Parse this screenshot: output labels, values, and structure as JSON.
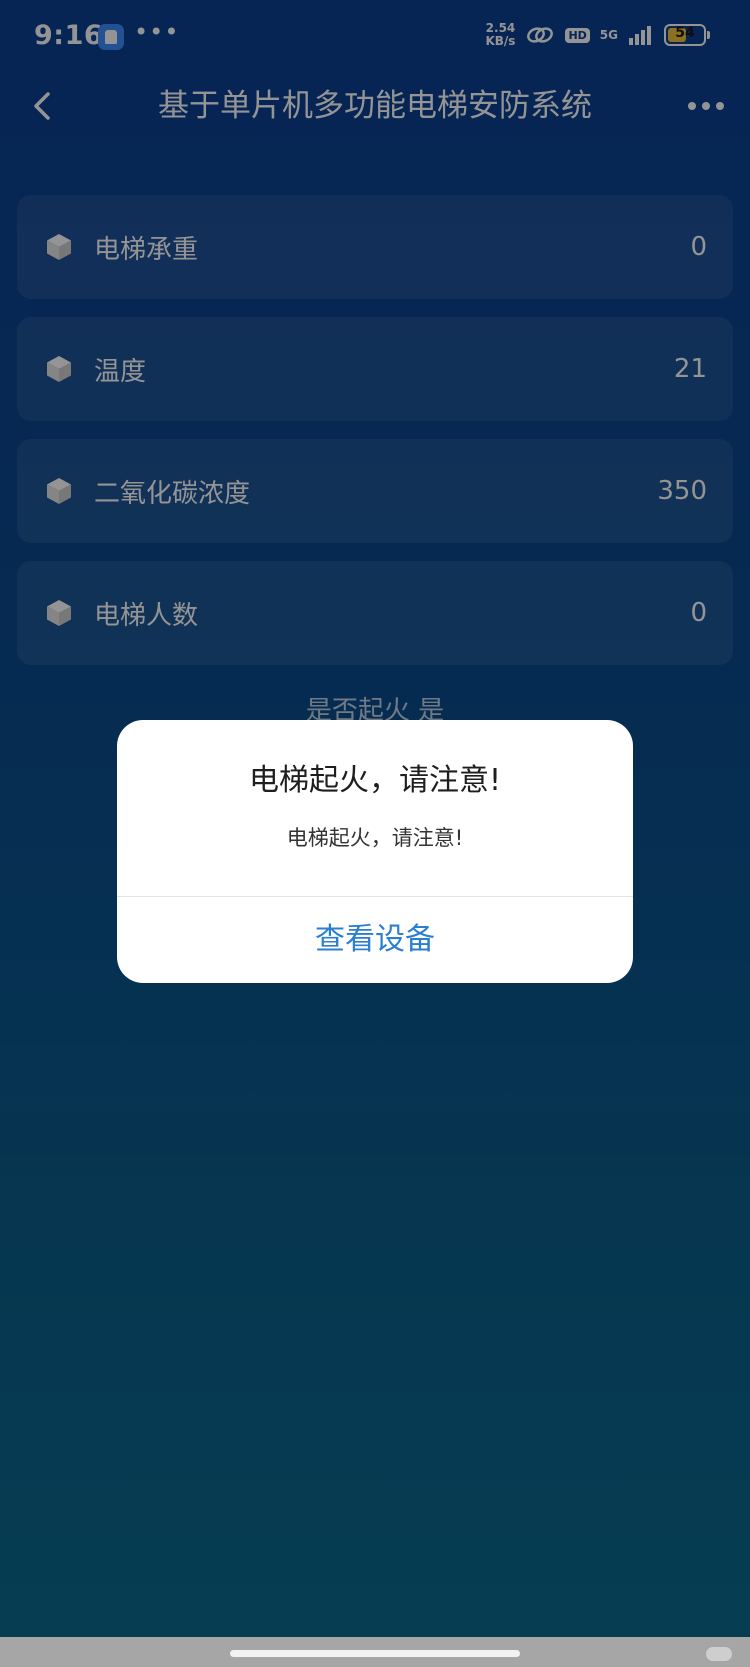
{
  "status_bar": {
    "time": "9:16",
    "more_dots": "•••",
    "speed_value": "2.54",
    "speed_unit": "KB/s",
    "hd_badge": "HD",
    "network": "5G",
    "battery_level": "54",
    "battery_fraction": 0.54,
    "battery_color": "#f3c13a"
  },
  "header": {
    "title": "基于单片机多功能电梯安防系统",
    "back_icon": "chevron-left-icon",
    "more_icon": "more-horizontal-icon"
  },
  "metrics": [
    {
      "label": "电梯承重",
      "value": "0",
      "icon": "cube-icon"
    },
    {
      "label": "温度",
      "value": "21",
      "icon": "cube-icon"
    },
    {
      "label": "二氧化碳浓度",
      "value": "350",
      "icon": "cube-icon"
    },
    {
      "label": "电梯人数",
      "value": "0",
      "icon": "cube-icon"
    }
  ],
  "fire_status": {
    "text": "是否起火 是"
  },
  "dialog": {
    "title": "电梯起火，请注意!",
    "message": "电梯起火，请注意!",
    "button_label": "查看设备",
    "button_color": "#2b7fd0"
  },
  "theme": {
    "background_top": "#0b3f91",
    "background_bottom": "#0c6b8f"
  }
}
